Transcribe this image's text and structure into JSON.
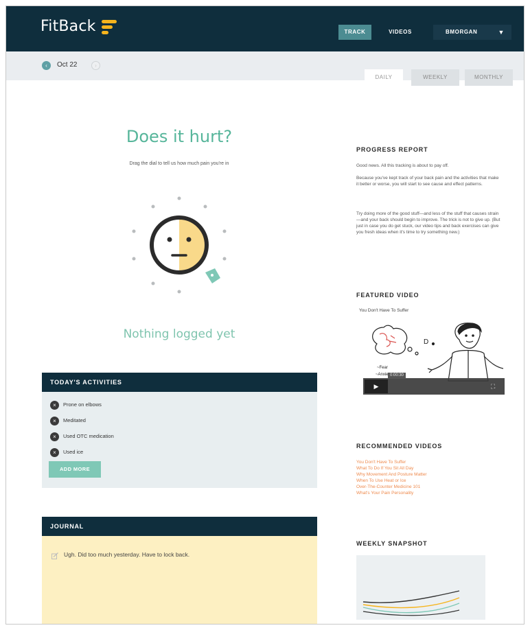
{
  "app": {
    "name": "FitBack"
  },
  "nav": {
    "track": "TRACK",
    "videos": "VIDEOS",
    "user": "BMORGAN",
    "caret": "▼"
  },
  "date": {
    "label": "Oct 22",
    "prev": "‹",
    "next": "›"
  },
  "tabs": [
    "DAILY",
    "WEEKLY",
    "MONTHLY"
  ],
  "main": {
    "title": "Does it hurt?",
    "subtitle": "Drag the dial to tell us how much pain you're in",
    "empty": "Nothing logged yet"
  },
  "activities": {
    "heading": "TODAY'S ACTIVITIES",
    "items": [
      "Prone on elbows",
      "Meditated",
      "Used OTC medication",
      "Used ice"
    ],
    "remove_icon": "×",
    "add_label": "ADD MORE"
  },
  "journal": {
    "heading": "JOURNAL",
    "entry": "Ugh. Did too much yesterday. Have to lock back."
  },
  "progress": {
    "heading": "PROGRESS REPORT",
    "p1": "Good news. All this tracking is about to pay off.",
    "p2": "Because you've kept track of your back pain and the activities that make it better or worse, you will start to see cause and effect patterns.",
    "p3": "Try doing more of the good stuff—and less of the stuff that causes strain—and your back should begin to improve. The trick is not to give up. (But just in case you do get stuck, our video tips and back exercises can give you fresh ideas when it's time to try something new.)"
  },
  "featured": {
    "heading": "FEATURED VIDEO",
    "title": "You Don't Have To Suffer",
    "time": "0:00:30",
    "play_icon": "▶",
    "fullscreen_icon": "⛶"
  },
  "recommended": {
    "heading": "RECOMMENDED VIDEOS",
    "links": [
      "You Don't Have To Suffer",
      "What To Do If You Sit All Day",
      "Why Movement And Posture Matter",
      "When To Use Heat or Ice",
      "Over-The-Counter Medicine 101",
      "What's Your Pain Personality"
    ]
  },
  "snapshot": {
    "heading": "WEEKLY SNAPSHOT"
  },
  "colors": {
    "navy": "#0f2e3d",
    "accent_teal": "#4c8c92",
    "green": "#56b59a",
    "link_orange": "#ee8a4d",
    "face_yellow": "#f9d98a",
    "journal_bg": "#fdf0c2"
  }
}
